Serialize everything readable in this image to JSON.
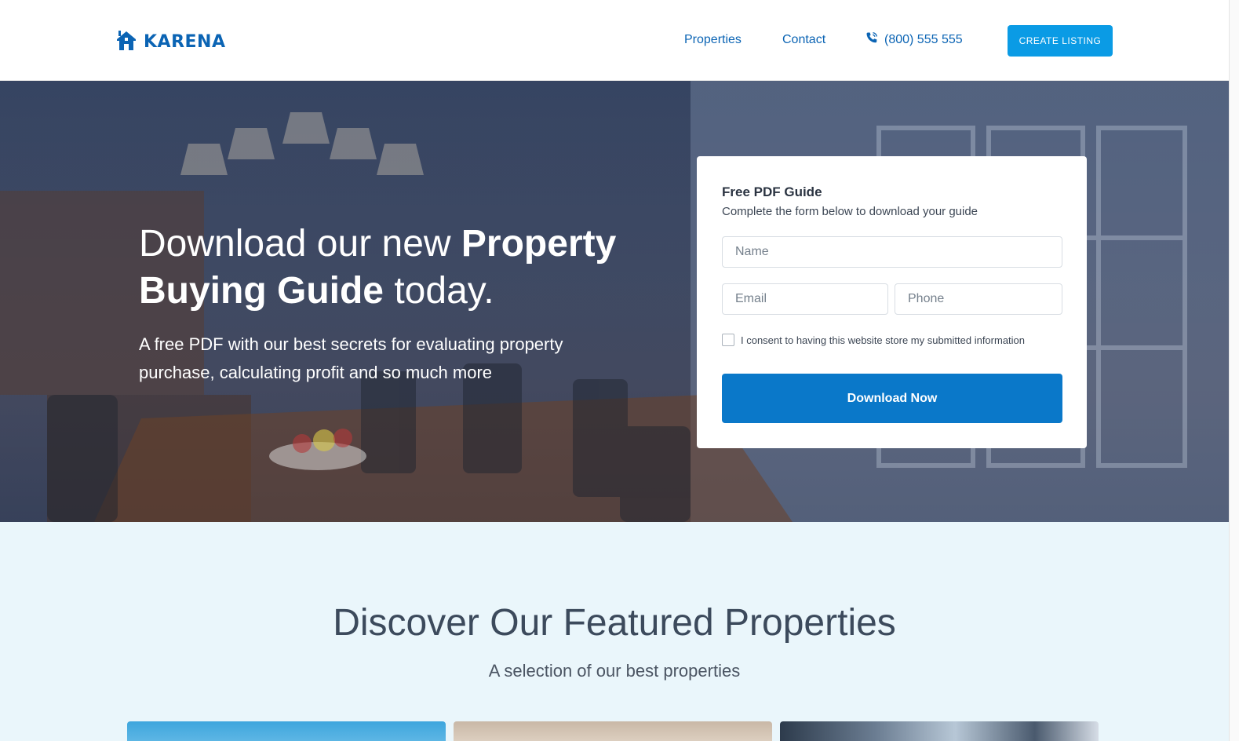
{
  "header": {
    "brand": "KARENA",
    "nav": {
      "properties": "Properties",
      "contact": "Contact",
      "phone": "(800) 555 555"
    },
    "cta_label": "CREATE LISTING"
  },
  "hero": {
    "title_part1": "Download our new ",
    "title_bold": "Property Buying Guide",
    "title_part2": " today.",
    "subtitle": "A free PDF with our best secrets for evaluating property purchase, calculating profit and so much more"
  },
  "form": {
    "title": "Free PDF Guide",
    "subtitle": "Complete the form below to download your guide",
    "name_placeholder": "Name",
    "email_placeholder": "Email",
    "phone_placeholder": "Phone",
    "consent_label": "I consent to having this website store my submitted information",
    "submit_label": "Download Now"
  },
  "featured": {
    "title": "Discover Our Featured Properties",
    "subtitle": "A selection of our best properties"
  },
  "colors": {
    "brand": "#0b64b4",
    "cta": "#0a9be5",
    "submit": "#0a78c9",
    "section_bg": "#eaf6fb"
  },
  "icons": {
    "logo": "house-icon",
    "phone": "phone-icon"
  }
}
